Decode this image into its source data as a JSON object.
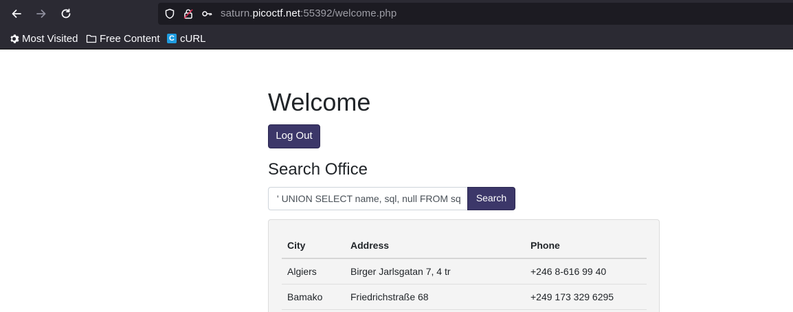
{
  "browser": {
    "url_prefix": "saturn.",
    "url_host": "picoctf.net",
    "url_suffix": ":55392/welcome.php",
    "bookmarks": [
      {
        "label": "Most Visited",
        "icon": "gear-icon"
      },
      {
        "label": "Free Content",
        "icon": "folder-icon"
      },
      {
        "label": "cURL",
        "icon": "curl-icon",
        "badge": "C"
      }
    ]
  },
  "page": {
    "title": "Welcome",
    "logout_label": "Log Out",
    "search_heading": "Search Office",
    "search_value": "' UNION SELECT name, sql, null FROM sq",
    "search_button_label": "Search",
    "table": {
      "headers": [
        "City",
        "Address",
        "Phone"
      ],
      "rows": [
        [
          "Algiers",
          "Birger Jarlsgatan 7, 4 tr",
          "+246 8-616 99 40"
        ],
        [
          "Bamako",
          "Friedrichstraße 68",
          "+249 173 329 6295"
        ]
      ]
    }
  },
  "colors": {
    "chrome_bg": "#2b2a33",
    "urlbar_bg": "#1c1b22",
    "button_bg": "#3c3769"
  }
}
